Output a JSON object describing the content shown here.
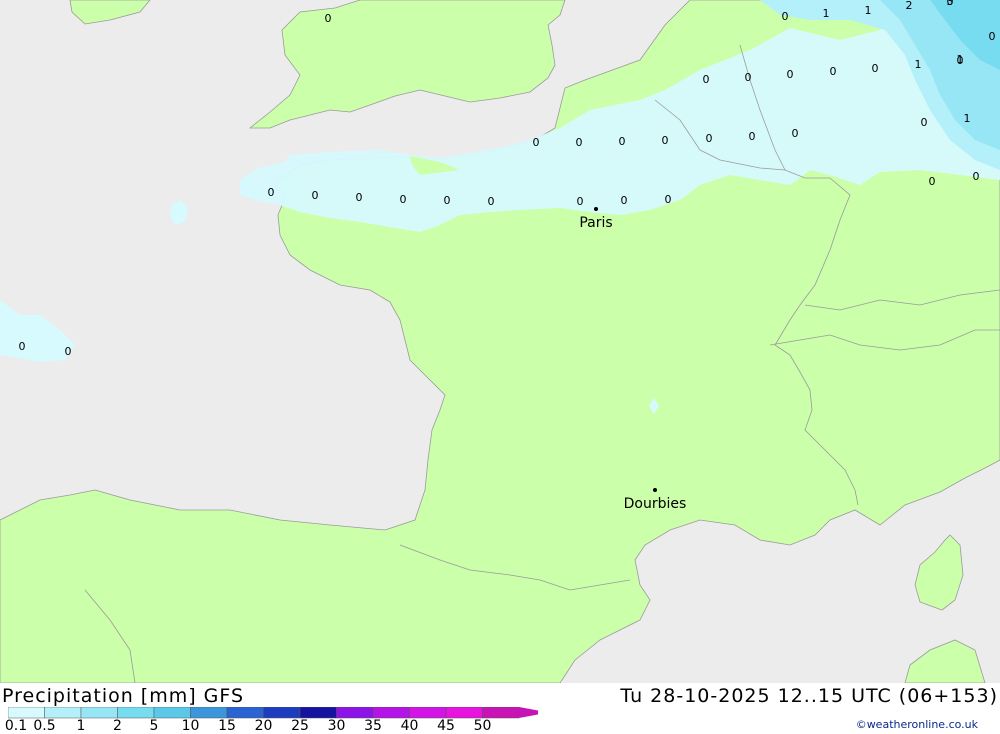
{
  "map": {
    "cities": [
      {
        "name": "Paris"
      },
      {
        "name": "Dourbies"
      }
    ],
    "contour_values": [
      "0",
      "0",
      "0",
      "0",
      "0",
      "0",
      "0",
      "0",
      "0",
      "0",
      "0",
      "0",
      "0",
      "0",
      "0",
      "0",
      "0",
      "0",
      "0",
      "0",
      "0",
      "0",
      "0",
      "0",
      "0",
      "0",
      "0",
      "0",
      "0",
      "0",
      "0",
      "1",
      "1",
      "1",
      "1",
      "1",
      "2",
      "3"
    ]
  },
  "footer": {
    "title": "Precipitation [mm] GFS",
    "datetime": "Tu 28-10-2025 12..15 UTC (06+153)",
    "credit": "©weatheronline.co.uk",
    "legend": {
      "labels": [
        "0.1",
        "0.5",
        "1",
        "2",
        "5",
        "10",
        "15",
        "20",
        "25",
        "30",
        "35",
        "40",
        "45",
        "50"
      ],
      "colors": [
        "#d6fafe",
        "#b4f0fa",
        "#96e6f5",
        "#78dcf0",
        "#5ac8e6",
        "#3c96dc",
        "#2a64d2",
        "#1e3cbe",
        "#1414a0",
        "#8c14e6",
        "#b414e6",
        "#d214e6",
        "#e614dc",
        "#c814b4"
      ]
    }
  }
}
